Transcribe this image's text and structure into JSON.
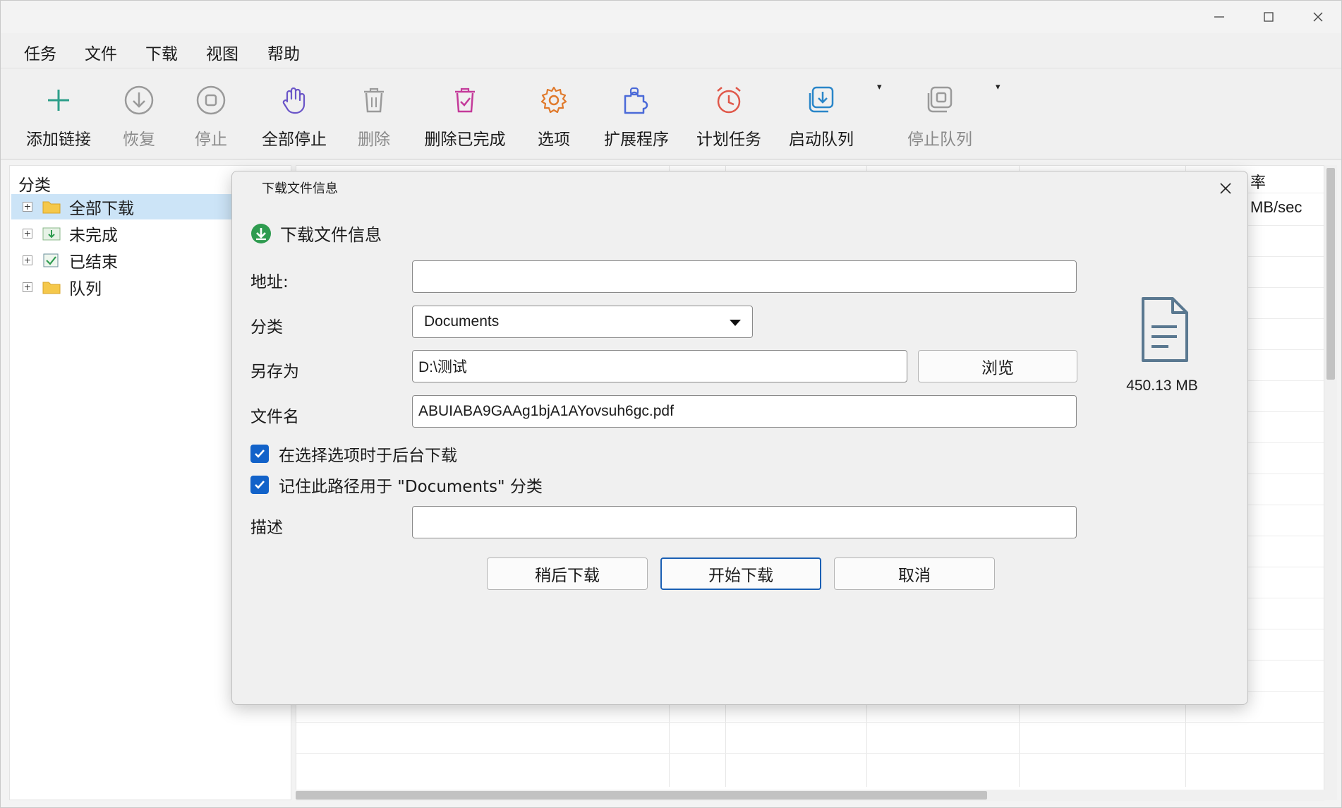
{
  "window": {
    "caption_buttons": [
      "minimize-icon",
      "maximize-icon",
      "close-icon"
    ]
  },
  "menu": [
    "任务",
    "文件",
    "下载",
    "视图",
    "帮助"
  ],
  "toolbar": {
    "items": [
      {
        "label": "添加链接",
        "icon": "plus-icon",
        "enabled": true
      },
      {
        "label": "恢复",
        "icon": "resume-icon",
        "enabled": false
      },
      {
        "label": "停止",
        "icon": "stop-icon",
        "enabled": false
      },
      {
        "label": "全部停止",
        "icon": "hand-icon",
        "enabled": true
      },
      {
        "label": "删除",
        "icon": "trash-icon",
        "enabled": false
      },
      {
        "label": "删除已完成",
        "icon": "trash-check-icon",
        "enabled": true
      },
      {
        "label": "选项",
        "icon": "gear-icon",
        "enabled": true
      },
      {
        "label": "扩展程序",
        "icon": "puzzle-icon",
        "enabled": true
      },
      {
        "label": "计划任务",
        "icon": "alarm-icon",
        "enabled": true
      },
      {
        "label": "启动队列",
        "icon": "queue-start-icon",
        "enabled": true
      },
      {
        "label": "停止队列",
        "icon": "queue-stop-icon",
        "enabled": false
      }
    ],
    "dropdown_glyph": "▾"
  },
  "sidebar": {
    "header": "分类",
    "items": [
      {
        "label": "全部下载",
        "icon": "folder-icon",
        "selected": true
      },
      {
        "label": "未完成",
        "icon": "download-folder-icon",
        "selected": false
      },
      {
        "label": "已结束",
        "icon": "check-folder-icon",
        "selected": false
      },
      {
        "label": "队列",
        "icon": "folder-icon",
        "selected": false
      }
    ]
  },
  "list": {
    "visible_header_fragment": "率",
    "visible_cell_fragment": "MB/sec"
  },
  "dialog": {
    "title": "下载文件信息",
    "header": "下载文件信息",
    "url_label": "地址:",
    "url_value": "",
    "category_label": "分类",
    "category_value": "Documents",
    "saveas_label": "另存为",
    "saveas_value": "D:\\测试",
    "browse_button": "浏览",
    "filename_label": "文件名",
    "filename_value": "ABUIABA9GAAg1bjA1AYovsuh6gc.pdf",
    "checkbox_background": "在选择选项时于后台下载",
    "checkbox_background_checked": true,
    "checkbox_remember": "记住此路径用于 \"Documents\" 分类",
    "checkbox_remember_checked": true,
    "description_label": "描述",
    "description_value": "",
    "later_button": "稍后下载",
    "start_button": "开始下载",
    "cancel_button": "取消",
    "file_size": "450.13 MB"
  },
  "colors": {
    "accent": "#1262c9",
    "selection": "#cce4f7",
    "download_green": "#2e9b4f"
  }
}
